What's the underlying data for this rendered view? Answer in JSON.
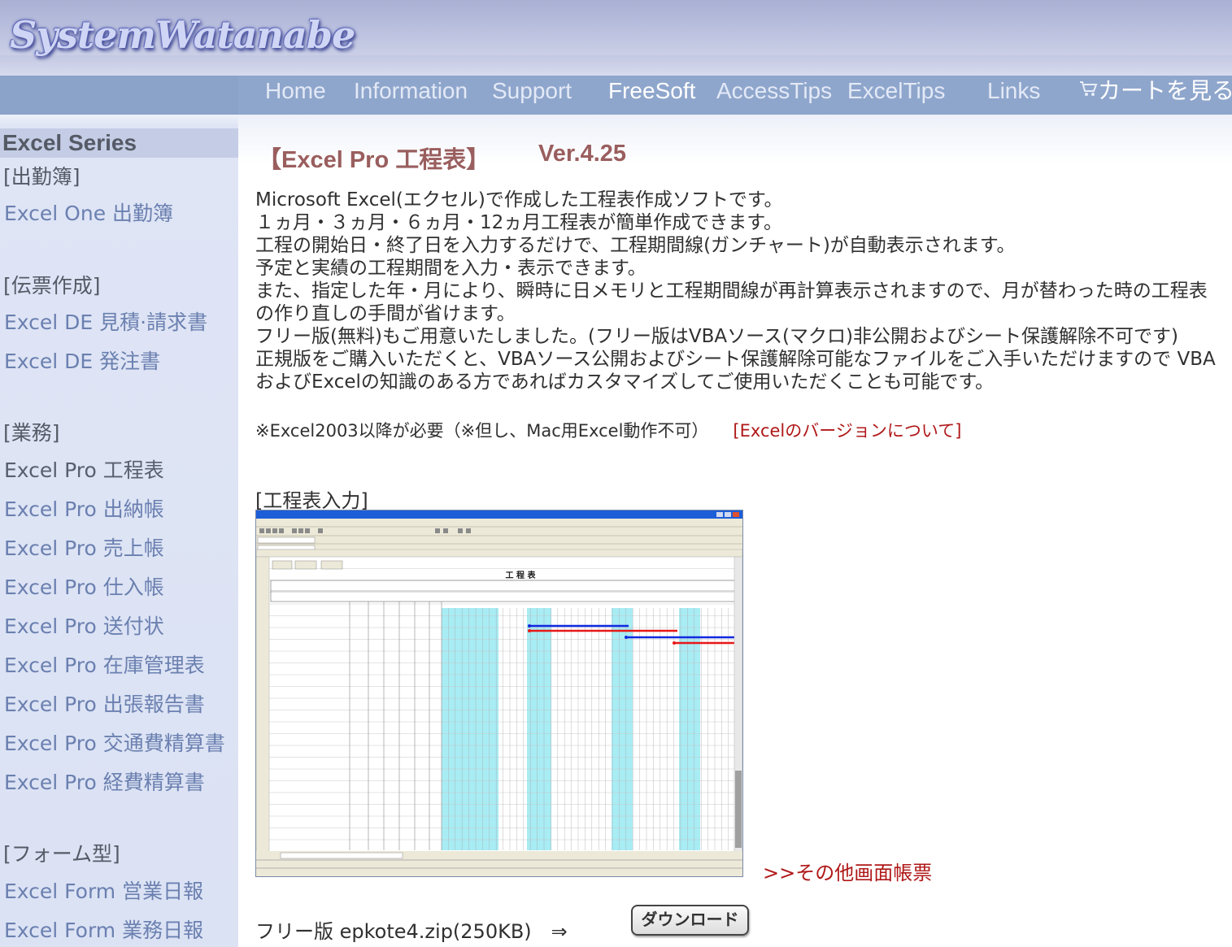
{
  "header": {
    "logo_text": "SystemWatanabe"
  },
  "nav": {
    "items": [
      {
        "label": "Home"
      },
      {
        "label": "Information"
      },
      {
        "label": "Support"
      },
      {
        "label": "FreeSoft",
        "active": true
      },
      {
        "label": "AccessTips"
      },
      {
        "label": "ExcelTips"
      },
      {
        "label": "Links"
      },
      {
        "label": "カートを見る",
        "icon": "cart-icon"
      }
    ]
  },
  "sidebar": {
    "title": "Excel Series",
    "categories": [
      {
        "label": "[出勤簿]",
        "items": [
          "Excel One 出勤簿"
        ]
      },
      {
        "label": "[伝票作成]",
        "items": [
          "Excel DE 見積·請求書",
          "Excel DE 発注書"
        ]
      },
      {
        "label": "[業務]",
        "items": [
          "Excel Pro 工程表",
          "Excel Pro 出納帳",
          "Excel Pro 売上帳",
          "Excel Pro 仕入帳",
          "Excel Pro 送付状",
          "Excel Pro 在庫管理表",
          "Excel Pro 出張報告書",
          "Excel Pro 交通費精算書",
          "Excel Pro 経費精算書"
        ]
      },
      {
        "label": "[フォーム型]",
        "items": [
          "Excel Form 営業日報",
          "Excel Form 業務日報"
        ]
      }
    ]
  },
  "main": {
    "title": "【Excel Pro 工程表】",
    "version": "Ver.4.25",
    "description": [
      "Microsoft Excel(エクセル)で作成した工程表作成ソフトです。",
      "１ヵ月・３ヵ月・６ヵ月・12ヵ月工程表が簡単作成できます。",
      "工程の開始日・終了日を入力するだけで、工程期間線(ガンチャート)が自動表示されます。",
      "予定と実績の工程期間を入力・表示できます。",
      "また、指定した年・月により、瞬時に日メモリと工程期間線が再計算表示されますので、月が替わった時の工程表の作り直しの手間が省けます。",
      "フリー版(無料)もご用意いたしました。(フリー版はVBAソース(マクロ)非公開およびシート保護解除不可です)",
      "正規版をご購入いただくと、VBAソース公開およびシート保護解除可能なファイルをご入手いただけますので VBAおよびExcelの知識のある方であればカスタマイズしてご使用いただくことも可能です。"
    ],
    "requirement": "※Excel2003以降が必要（※但し、Mac用Excel動作不可）",
    "version_link": "[Excelのバージョンについて]",
    "section_label": "[工程表入力]",
    "screenshot": {
      "sheet_title": "工 程 表",
      "colors": {
        "plan": "#1028e0",
        "actual": "#e81818",
        "highlight": "#a8ecf4"
      }
    },
    "other_link": ">>その他画面帳票",
    "download_text": "フリー版 epkote4.zip(250KB)　⇒",
    "download_button": "ダウンロード"
  }
}
